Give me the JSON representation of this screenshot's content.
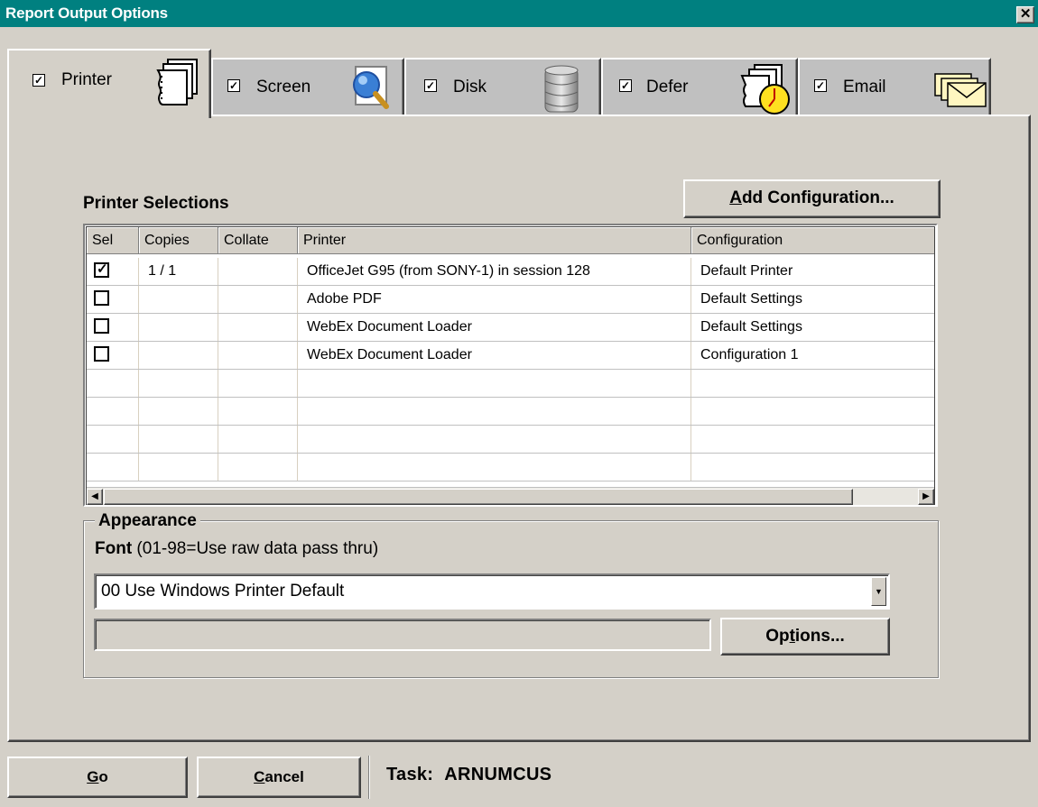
{
  "window": {
    "title": "Report Output Options",
    "close_glyph": "✕"
  },
  "tabs": [
    {
      "label": "Printer",
      "checked": true,
      "icon": "printer-pages-icon",
      "active": true
    },
    {
      "label": "Screen",
      "checked": true,
      "icon": "magnifier-icon",
      "active": false
    },
    {
      "label": "Disk",
      "checked": true,
      "icon": "database-icon",
      "active": false
    },
    {
      "label": "Defer",
      "checked": true,
      "icon": "clock-pages-icon",
      "active": false
    },
    {
      "label": "Email",
      "checked": true,
      "icon": "envelope-icon",
      "active": false
    }
  ],
  "printer_selections": {
    "title": "Printer Selections",
    "add_config_label": "dd Configuration...",
    "add_config_accel": "A",
    "columns": [
      "Sel",
      "Copies",
      "Collate",
      "Printer",
      "Configuration"
    ],
    "rows": [
      {
        "sel": true,
        "copies": "1 / 1",
        "collate": "",
        "printer": "OfficeJet G95 (from SONY-1) in session 128",
        "configuration": "Default Printer"
      },
      {
        "sel": false,
        "copies": "",
        "collate": "",
        "printer": "Adobe PDF",
        "configuration": "Default Settings"
      },
      {
        "sel": false,
        "copies": "",
        "collate": "",
        "printer": "WebEx Document Loader",
        "configuration": "Default Settings"
      },
      {
        "sel": false,
        "copies": "",
        "collate": "",
        "printer": "WebEx Document Loader",
        "configuration": "Configuration 1"
      }
    ],
    "check_glyph": "✓"
  },
  "appearance": {
    "legend": "Appearance",
    "font_label_bold": "Font",
    "font_label_rest": " (01-98=Use raw data pass thru)",
    "font_value": "00 Use Windows Printer Default",
    "options_pre": "Op",
    "options_accel": "t",
    "options_post": "ions..."
  },
  "footer": {
    "go_accel": "G",
    "go_rest": "o",
    "cancel_accel": "C",
    "cancel_rest": "ancel",
    "task_label": "Task:",
    "task_value": "ARNUMCUS"
  }
}
